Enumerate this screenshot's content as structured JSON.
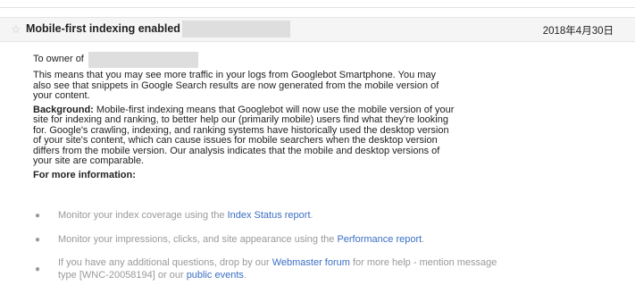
{
  "header": {
    "star_icon": "star-outline-icon",
    "subject": "Mobile-first indexing enabled for",
    "date": "2018年4月30日"
  },
  "body": {
    "greeting": "To owner of",
    "para1": "This means that you may see more traffic in your logs from Googlebot Smartphone. You may also see that snippets in Google Search results are now generated from the mobile version of your content.",
    "background_label": "Background:",
    "background_text": " Mobile-first indexing means that Googlebot will now use the mobile version of your site for indexing and ranking, to better help our (primarily mobile) users find what they're looking for. Google's crawling, indexing, and ranking systems have historically used the desktop version of your site's content, which can cause issues for mobile searchers when the desktop version differs from the mobile version. Our analysis indicates that the mobile and desktop versions of your site are comparable.",
    "more_info": "For more information:"
  },
  "bullets": [
    {
      "pre": "Monitor your index coverage using the ",
      "link": "Index Status report",
      "post": "."
    },
    {
      "pre": "Monitor your impressions, clicks, and site appearance using the ",
      "link": "Performance report",
      "post": "."
    },
    {
      "pre": "If you have any additional questions, drop by our ",
      "link": "Webmaster forum",
      "mid": " for more help - mention message type [WNC-20058194] or our ",
      "link2": "public events",
      "post": "."
    }
  ],
  "colors": {
    "link": "#3a6ec4",
    "bullet_text": "#999999",
    "redaction": "#dedede"
  }
}
